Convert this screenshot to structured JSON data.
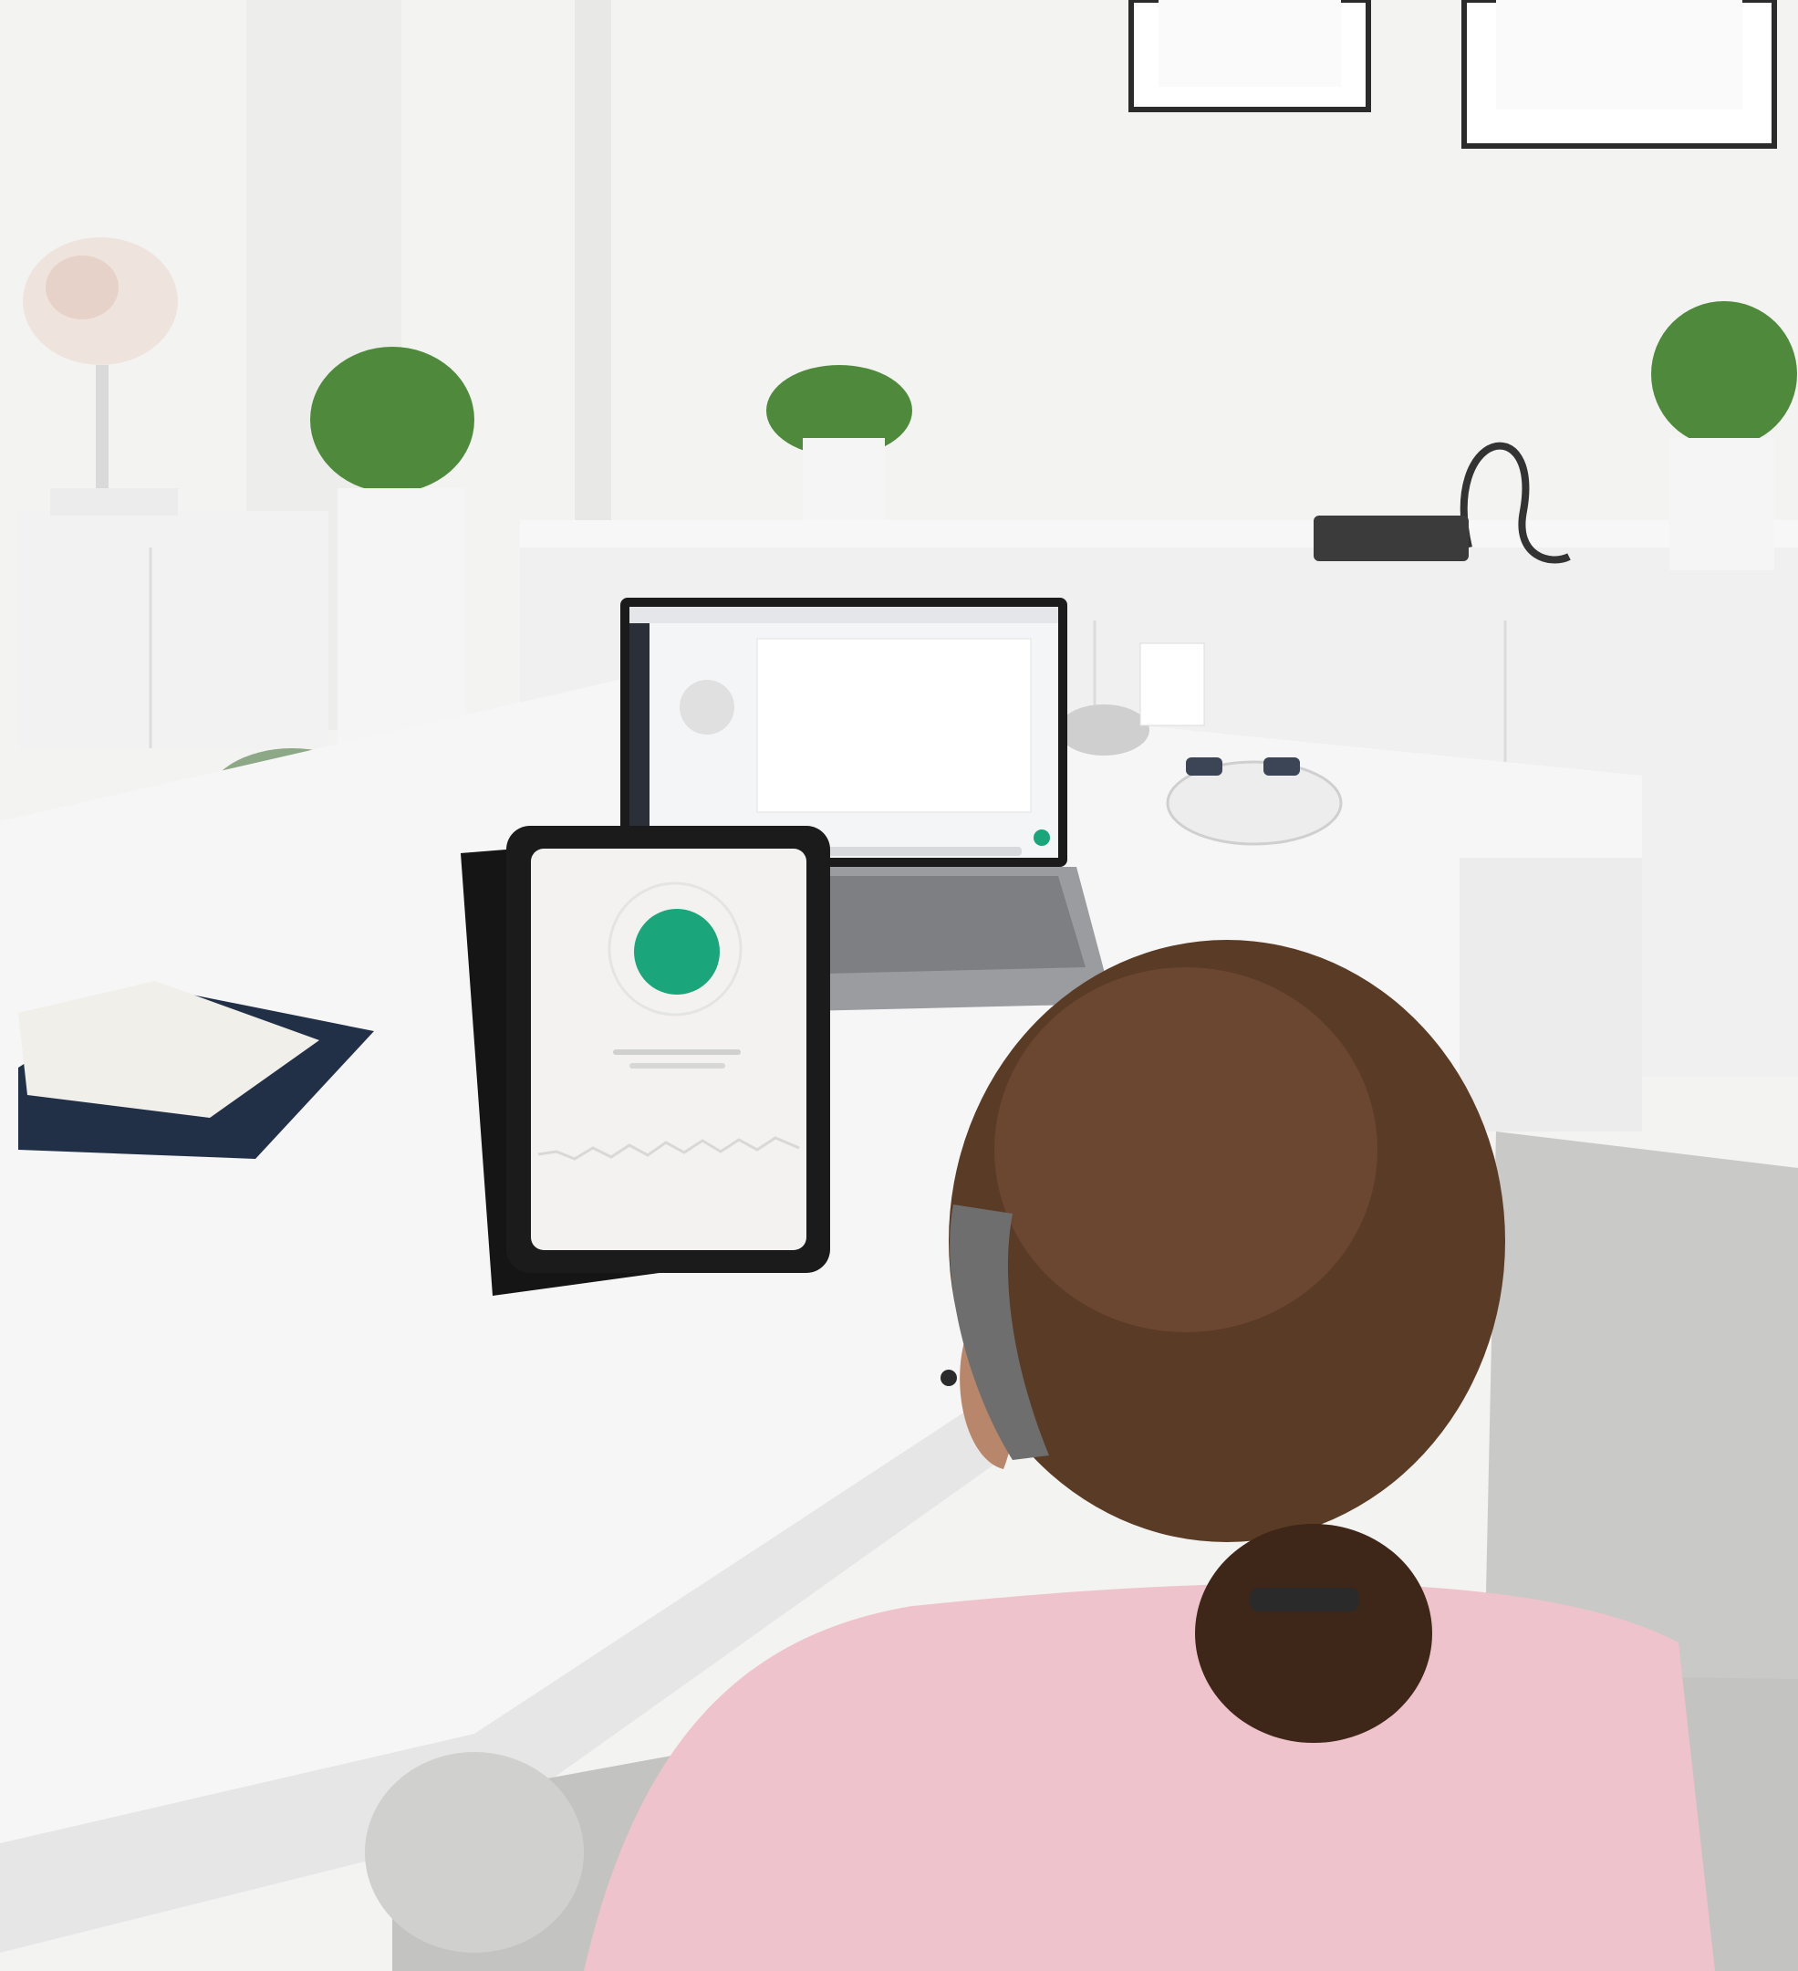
{
  "scene": {
    "description_tokens": [],
    "colors": {
      "wall": "#f3f3f2",
      "wall_shadow": "#e4e4e3",
      "desk_top": "#f6f6f6",
      "desk_edge": "#e9e9e9",
      "floor": "#dcdcdc",
      "sofa": "#c9c9c7",
      "sofa_dark": "#b3b3b1",
      "hair": "#5a3b26",
      "hair_dark": "#3e2718",
      "shirt": "#efc3cb",
      "headset": "#6e6e6e",
      "tablet_frame": "#1b1b1b",
      "tablet_screen": "#f3f2f0",
      "accent_green": "#1aa67a",
      "laptop_body": "#9a9c9f",
      "laptop_screen": "#f4f5f7",
      "plant": "#4f8a3c",
      "folder": "#223047"
    },
    "icons": {
      "tablet_status": "green-ring-indicator",
      "laptop_fab": "green-round-button",
      "laptop_sidebar": "vertical-icon-strip"
    }
  }
}
